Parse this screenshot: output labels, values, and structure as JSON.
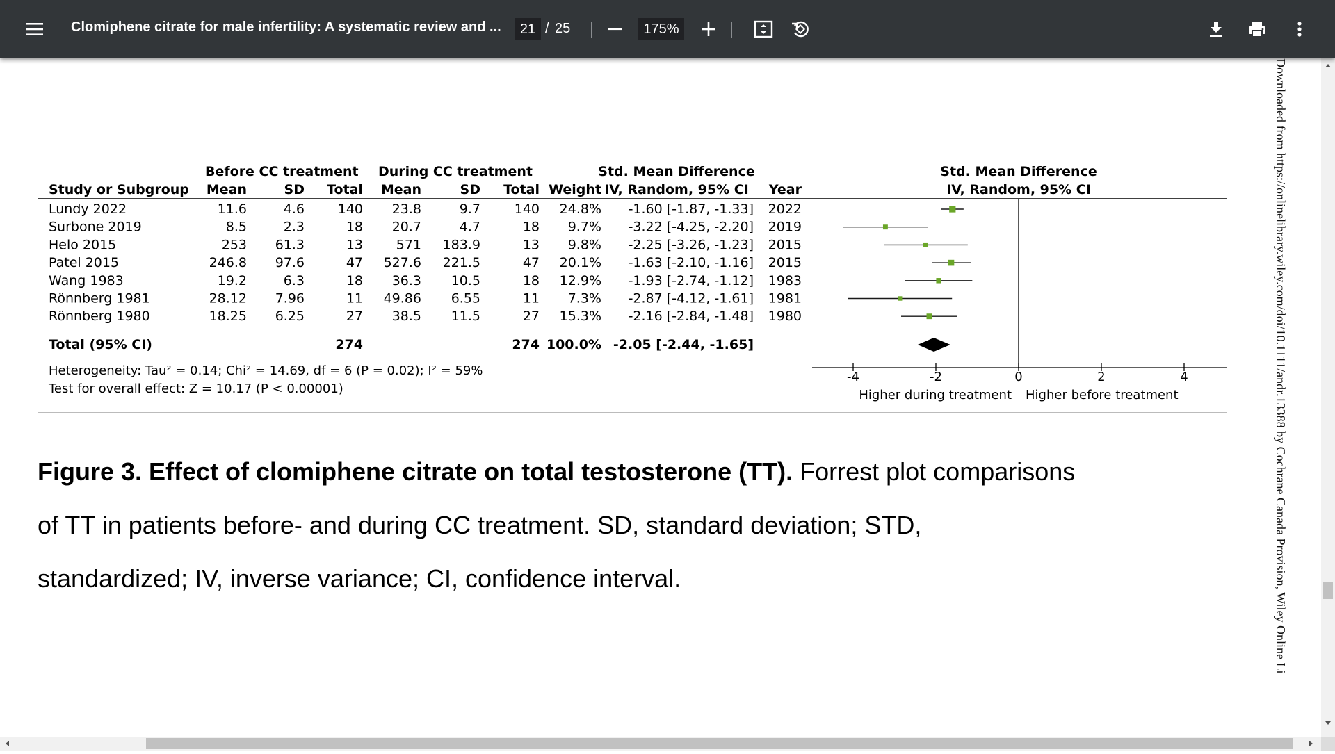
{
  "toolbar": {
    "title": "Clomiphene citrate for male infertility: A systematic review and ...",
    "page_current": "21",
    "page_separator": "/",
    "page_total": "25",
    "zoom": "175%",
    "icons": {
      "menu": "menu-icon",
      "zoom_out": "minus-icon",
      "zoom_in": "plus-icon",
      "fit": "fit-page-icon",
      "rotate": "rotate-icon",
      "download": "download-icon",
      "print": "print-icon",
      "more": "more-vert-icon"
    }
  },
  "forest": {
    "col_headers": {
      "study": "Study or Subgroup",
      "group_before": "Before CC treatment",
      "group_during": "During CC treatment",
      "smd_group": "Std. Mean Difference",
      "mean": "Mean",
      "sd": "SD",
      "total": "Total",
      "weight": "Weight",
      "method": "IV, Random, 95% CI",
      "year": "Year",
      "plot_group": "Std. Mean Difference",
      "plot_method": "IV, Random, 95% CI"
    },
    "studies": [
      {
        "study": "Lundy 2022",
        "b_mean": "11.6",
        "b_sd": "4.6",
        "b_total": "140",
        "d_mean": "23.8",
        "d_sd": "9.7",
        "d_total": "140",
        "weight": "24.8%",
        "ci": "-1.60 [-1.87, -1.33]",
        "year": "2022",
        "est": -1.6,
        "lo": -1.87,
        "hi": -1.33,
        "w": 24.8
      },
      {
        "study": "Surbone 2019",
        "b_mean": "8.5",
        "b_sd": "2.3",
        "b_total": "18",
        "d_mean": "20.7",
        "d_sd": "4.7",
        "d_total": "18",
        "weight": "9.7%",
        "ci": "-3.22 [-4.25, -2.20]",
        "year": "2019",
        "est": -3.22,
        "lo": -4.25,
        "hi": -2.2,
        "w": 9.7
      },
      {
        "study": "Helo 2015",
        "b_mean": "253",
        "b_sd": "61.3",
        "b_total": "13",
        "d_mean": "571",
        "d_sd": "183.9",
        "d_total": "13",
        "weight": "9.8%",
        "ci": "-2.25 [-3.26, -1.23]",
        "year": "2015",
        "est": -2.25,
        "lo": -3.26,
        "hi": -1.23,
        "w": 9.8
      },
      {
        "study": "Patel 2015",
        "b_mean": "246.8",
        "b_sd": "97.6",
        "b_total": "47",
        "d_mean": "527.6",
        "d_sd": "221.5",
        "d_total": "47",
        "weight": "20.1%",
        "ci": "-1.63 [-2.10, -1.16]",
        "year": "2015",
        "est": -1.63,
        "lo": -2.1,
        "hi": -1.16,
        "w": 20.1
      },
      {
        "study": "Wang 1983",
        "b_mean": "19.2",
        "b_sd": "6.3",
        "b_total": "18",
        "d_mean": "36.3",
        "d_sd": "10.5",
        "d_total": "18",
        "weight": "12.9%",
        "ci": "-1.93 [-2.74, -1.12]",
        "year": "1983",
        "est": -1.93,
        "lo": -2.74,
        "hi": -1.12,
        "w": 12.9
      },
      {
        "study": "Rönnberg 1981",
        "b_mean": "28.12",
        "b_sd": "7.96",
        "b_total": "11",
        "d_mean": "49.86",
        "d_sd": "6.55",
        "d_total": "11",
        "weight": "7.3%",
        "ci": "-2.87 [-4.12, -1.61]",
        "year": "1981",
        "est": -2.87,
        "lo": -4.12,
        "hi": -1.61,
        "w": 7.3
      },
      {
        "study": "Rönnberg 1980",
        "b_mean": "18.25",
        "b_sd": "6.25",
        "b_total": "27",
        "d_mean": "38.5",
        "d_sd": "11.5",
        "d_total": "27",
        "weight": "15.3%",
        "ci": "-2.16 [-2.84, -1.48]",
        "year": "1980",
        "est": -2.16,
        "lo": -2.84,
        "hi": -1.48,
        "w": 15.3
      }
    ],
    "total": {
      "label": "Total (95% CI)",
      "b_total": "274",
      "d_total": "274",
      "weight": "100.0%",
      "ci": "-2.05 [-2.44, -1.65]",
      "est": -2.05,
      "lo": -2.44,
      "hi": -1.65
    },
    "heterogeneity": "Heterogeneity: Tau² = 0.14; Chi² = 14.69, df = 6 (P = 0.02); I² = 59%",
    "overall_effect": "Test for overall effect: Z = 10.17 (P < 0.00001)",
    "axis": {
      "min": -5,
      "max": 5,
      "ticks": [
        "-4",
        "-2",
        "0",
        "2",
        "4"
      ],
      "tick_values": [
        -4,
        -2,
        0,
        2,
        4
      ]
    },
    "favours_left": "Higher during treatment",
    "favours_right": "Higher before treatment"
  },
  "caption": {
    "bold": "Figure 3. Effect of clomiphene citrate on total testosterone (TT).",
    "line1_rest": " Forrest plot comparisons",
    "line2": "of TT in patients before- and during CC treatment. SD, standard deviation; STD,",
    "line3": "standardized; IV, inverse variance; CI, confidence interval."
  },
  "side_note": "Downloaded from https://onlinelibrary.wiley.com/doi/10.1111/andr.13388 by Cochrane Canada Provision, Wiley Online Li",
  "colors": {
    "toolbar_bg": "#323639",
    "marker": "#6aa628",
    "diamond": "#000000"
  },
  "chart_data": {
    "type": "scatter",
    "title": "",
    "x_label": "Std. Mean Difference IV, Random, 95% CI",
    "xlim": [
      -5,
      5
    ],
    "categories": [
      "Lundy 2022",
      "Surbone 2019",
      "Helo 2015",
      "Patel 2015",
      "Wang 1983",
      "Rönnberg 1981",
      "Rönnberg 1980",
      "Total (95% CI)"
    ],
    "series": [
      {
        "name": "estimate",
        "values": [
          -1.6,
          -3.22,
          -2.25,
          -1.63,
          -1.93,
          -2.87,
          -2.16,
          -2.05
        ]
      },
      {
        "name": "ci_low",
        "values": [
          -1.87,
          -4.25,
          -3.26,
          -2.1,
          -2.74,
          -4.12,
          -2.84,
          -2.44
        ]
      },
      {
        "name": "ci_high",
        "values": [
          -1.33,
          -2.2,
          -1.23,
          -1.16,
          -1.12,
          -1.61,
          -1.48,
          -1.65
        ]
      }
    ]
  }
}
